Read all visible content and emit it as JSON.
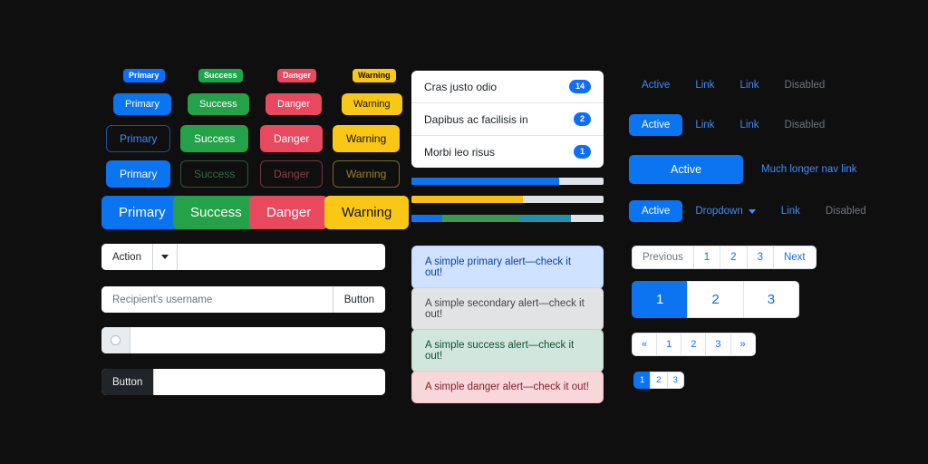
{
  "theme": {
    "background": "#0f0f0f",
    "primary": "#0b74f0",
    "success": "#24a149",
    "danger": "#e8495f",
    "warning": "#f9c816",
    "link": "#3f8cf5",
    "muted": "#6c757d"
  },
  "badges": [
    {
      "label": "Primary",
      "variant": "primary"
    },
    {
      "label": "Success",
      "variant": "success"
    },
    {
      "label": "Danger",
      "variant": "danger"
    },
    {
      "label": "Warning",
      "variant": "warning"
    }
  ],
  "buttons": {
    "row_small": [
      "Primary",
      "Success",
      "Danger",
      "Warning"
    ],
    "row_medium": [
      "Primary",
      "Success",
      "Danger",
      "Warning"
    ],
    "row_mixed": [
      "Primary",
      "Success",
      "Danger",
      "Warning"
    ],
    "row_large": [
      "Primary",
      "Success",
      "Danger",
      "Warning"
    ]
  },
  "list_group": {
    "items": [
      {
        "label": "Cras justo odio",
        "count": "14"
      },
      {
        "label": "Dapibus ac facilisis in",
        "count": "2"
      },
      {
        "label": "Morbi leo risus",
        "count": "1"
      }
    ]
  },
  "progress": [
    {
      "name": "primary-progress",
      "segments": [
        {
          "color": "#0b74f0",
          "percent": 77
        }
      ]
    },
    {
      "name": "warning-progress",
      "segments": [
        {
          "color": "#f6bf12",
          "percent": 58
        }
      ]
    },
    {
      "name": "stacked-progress",
      "segments": [
        {
          "color": "#0b74f0",
          "percent": 16
        },
        {
          "color": "#3a9a54",
          "percent": 40
        },
        {
          "color": "#2193a8",
          "percent": 27
        }
      ]
    }
  ],
  "alerts": [
    {
      "text": "A simple primary alert—check it out!",
      "variant": "primary"
    },
    {
      "text": "A simple secondary alert—check it out!",
      "variant": "secondary"
    },
    {
      "text": "A simple success alert—check it out!",
      "variant": "success"
    },
    {
      "text": "A simple danger alert—check it out!",
      "variant": "danger"
    }
  ],
  "input_groups": {
    "dropdown": {
      "action_label": "Action",
      "caret_icon": "chevron-down-icon",
      "value": ""
    },
    "recipient": {
      "placeholder": "Recipient's username",
      "button_label": "Button",
      "value": ""
    },
    "radio": {
      "addon_icon": "radio-button-icon",
      "value": ""
    },
    "button_prefix": {
      "button_label": "Button",
      "value": ""
    }
  },
  "nav": {
    "row_links": [
      "Active",
      "Link",
      "Link",
      "Disabled"
    ],
    "row_pills": [
      "Active",
      "Link",
      "Link",
      "Disabled"
    ],
    "row_fill": {
      "active": "Active",
      "long": "Much longer nav link"
    },
    "row_dropdown": {
      "active": "Active",
      "dropdown": "Dropdown",
      "caret_icon": "chevron-down-icon",
      "link": "Link",
      "disabled": "Disabled"
    }
  },
  "pagination": {
    "default": [
      "Previous",
      "1",
      "2",
      "3",
      "Next"
    ],
    "large": [
      "1",
      "2",
      "3"
    ],
    "small": [
      "«",
      "1",
      "2",
      "3",
      "»"
    ],
    "xsmall": [
      "1",
      "2",
      "3"
    ]
  }
}
